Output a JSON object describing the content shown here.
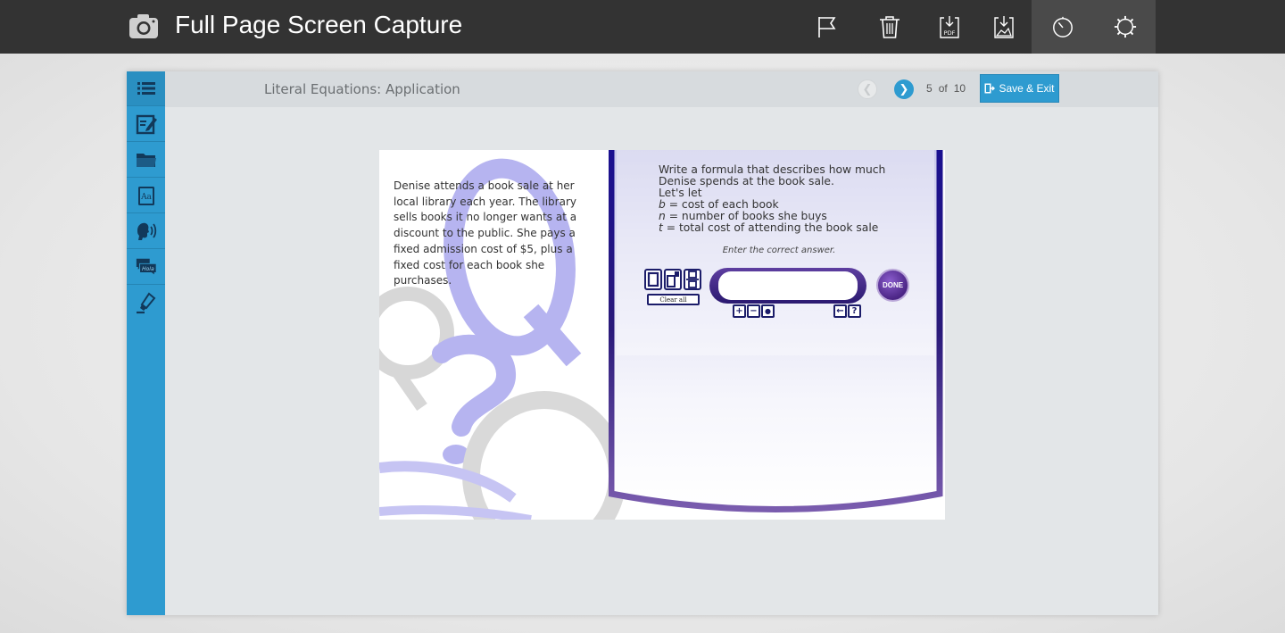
{
  "app": {
    "title": "Full Page Screen Capture",
    "toolbar": [
      {
        "name": "flag-icon"
      },
      {
        "name": "trash-icon"
      },
      {
        "name": "download-pdf-icon",
        "label": "PDF"
      },
      {
        "name": "download-image-icon"
      },
      {
        "name": "timer-icon",
        "active": true
      },
      {
        "name": "settings-gear-icon",
        "active": true
      }
    ]
  },
  "sidebar": {
    "items": [
      {
        "name": "list-icon"
      },
      {
        "name": "notes-edit-icon"
      },
      {
        "name": "folder-icon"
      },
      {
        "name": "glossary-book-icon",
        "label": "Aa"
      },
      {
        "name": "read-aloud-speaker-icon"
      },
      {
        "name": "translate-chat-icon",
        "label": "Hola"
      },
      {
        "name": "highlighter-icon"
      }
    ]
  },
  "header": {
    "lesson_title": "Literal Equations: Application",
    "page_current": "5",
    "page_of": "of",
    "page_total": "10",
    "save_exit_label": "Save & Exit"
  },
  "problem": {
    "text": "Denise attends a book sale at her local library each year. The library sells books it no longer wants at a discount to the public. She pays a fixed admission cost of $5, plus a fixed cost for each book she purchases."
  },
  "question": {
    "line1": "Write a formula that describes how much",
    "line2": "Denise spends at the book sale.",
    "line3": "Let's let",
    "var_b": "b",
    "def_b": " = cost of each book",
    "var_n": "n",
    "def_n": " = number of books she buys",
    "var_t": "t",
    "def_t": " = total cost of attending the book sale",
    "instruction": "Enter the correct answer."
  },
  "answer": {
    "value": "",
    "placeholder": "",
    "clear_label": "Clear all",
    "done_label": "DONE",
    "keys": [
      "+",
      "−",
      "●",
      "←",
      "?"
    ]
  },
  "colors": {
    "topbar": "#333333",
    "accent": "#2e9bd0",
    "panel_purple": "#2a1970",
    "watermark": "#b6b4f0"
  }
}
